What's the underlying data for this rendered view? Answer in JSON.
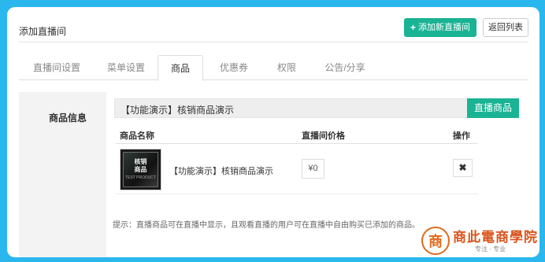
{
  "header": {
    "title": "添加直播间",
    "add_button": "添加新直播间",
    "back_button": "返回列表"
  },
  "tabs": [
    {
      "label": "直播间设置",
      "active": false
    },
    {
      "label": "菜单设置",
      "active": false
    },
    {
      "label": "商品",
      "active": true
    },
    {
      "label": "优惠券",
      "active": false
    },
    {
      "label": "权限",
      "active": false
    },
    {
      "label": "公告/分享",
      "active": false
    }
  ],
  "goods_section": {
    "label": "商品信息",
    "selected_goods": "【功能演示】核销商品演示",
    "live_goods_button": "直播商品",
    "columns": [
      "商品名称",
      "直播间价格",
      "操作"
    ],
    "rows": [
      {
        "thumb_text_line1": "核销",
        "thumb_text_line2": "商品",
        "thumb_text_line3": "TEST PRODUCT",
        "name": "【功能演示】核销商品演示",
        "price": "¥0",
        "action_icon": "close-icon",
        "action_glyph": "✖"
      }
    ],
    "hint": "提示：直播商品可在直播中显示，且观看直播的用户可在直播中自由购买已添加的商品。"
  },
  "watermark": {
    "text": "商此電商學院",
    "slogan": "专注 · 专业"
  },
  "colors": {
    "primary": "#1ab394",
    "background": "#2ab7ee",
    "watermark": "#d9551c"
  }
}
